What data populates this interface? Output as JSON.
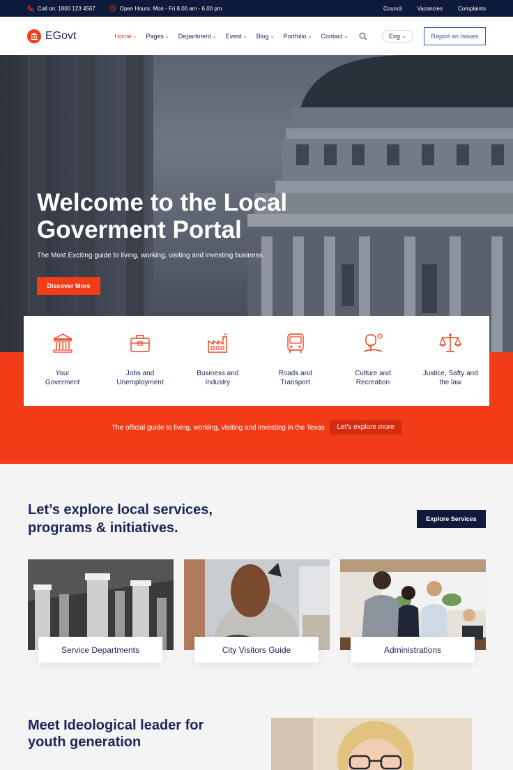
{
  "topbar": {
    "phone": "Call on: 1800 123 4567",
    "hours": "Open Hours: Mon - Fri 8.00 am - 6.00 pm",
    "links": [
      "Council",
      "Vacancies",
      "Complaints"
    ]
  },
  "header": {
    "logo_text": "EGovt",
    "nav": [
      "Home",
      "Pages",
      "Department",
      "Event",
      "Blog",
      "Portfolio",
      "Contact"
    ],
    "active_nav": "Home",
    "language": "Eng",
    "report_button": "Report an Issues"
  },
  "hero": {
    "title_line1": "Welcome to the Local",
    "title_line2": "Goverment Portal",
    "subtitle": "The Most Exciting guide to living, working, visiting and investing business.",
    "cta": "Discover More"
  },
  "services": [
    {
      "line1": "Your",
      "line2": "Goverment",
      "icon": "government-building-icon"
    },
    {
      "line1": "Jobs and",
      "line2": "Unemployment",
      "icon": "briefcase-icon"
    },
    {
      "line1": "Business and",
      "line2": "Industry",
      "icon": "factory-icon"
    },
    {
      "line1": "Roads and",
      "line2": "Transport",
      "icon": "bus-icon"
    },
    {
      "line1": "Culture and",
      "line2": "Recreation",
      "icon": "tree-icon"
    },
    {
      "line1": "Justice, Safty and",
      "line2": "the law",
      "icon": "scales-icon"
    }
  ],
  "band": {
    "text": "The official guide to living, working, visiting and investing in the Texas",
    "button": "Let’s explore more"
  },
  "explore": {
    "title_line1": "Let’s explore local services,",
    "title_line2": "programs & initiatives.",
    "button": "Explore Services",
    "cards": [
      "Service Departments",
      "City Visitors Guide",
      "Administrations"
    ]
  },
  "leader": {
    "title_line1": "Meet Ideological leader for",
    "title_line2": "youth generation"
  },
  "colors": {
    "accent": "#f23c17",
    "navy": "#0e1a3b",
    "text": "#1c2557",
    "link_blue": "#2b57b8"
  }
}
